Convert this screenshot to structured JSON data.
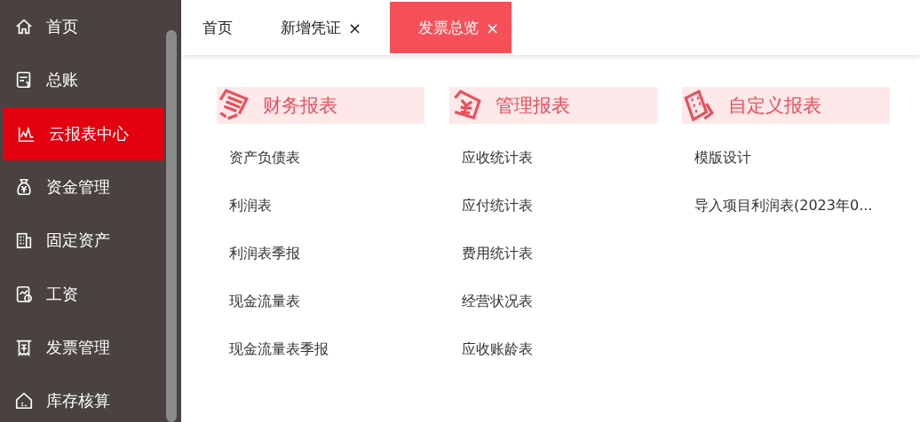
{
  "sidebar": {
    "items": [
      {
        "label": "首页",
        "selected": false
      },
      {
        "label": "总账",
        "selected": false
      },
      {
        "label": "云报表中心",
        "selected": true
      },
      {
        "label": "资金管理",
        "selected": false
      },
      {
        "label": "固定资产",
        "selected": false
      },
      {
        "label": "工资",
        "selected": false
      },
      {
        "label": "发票管理",
        "selected": false
      },
      {
        "label": "库存核算",
        "selected": false
      }
    ]
  },
  "tabs": [
    {
      "label": "首页",
      "selected": false
    },
    {
      "label": "新增凭证",
      "selected": false,
      "close": "×"
    },
    {
      "label": "发票总览",
      "selected": true,
      "close": "×"
    }
  ],
  "sections": [
    {
      "title": "财务报表",
      "items": [
        "资产负债表",
        "利润表",
        "利润表季报",
        "现金流量表",
        "现金流量表季报"
      ]
    },
    {
      "title": "管理报表",
      "items": [
        "应收统计表",
        "应付统计表",
        "费用统计表",
        "经营状况表",
        "应收账龄表"
      ]
    },
    {
      "title": "自定义报表",
      "items": [
        "模版设计",
        "导入项目利润表(2023年0..."
      ]
    }
  ]
}
